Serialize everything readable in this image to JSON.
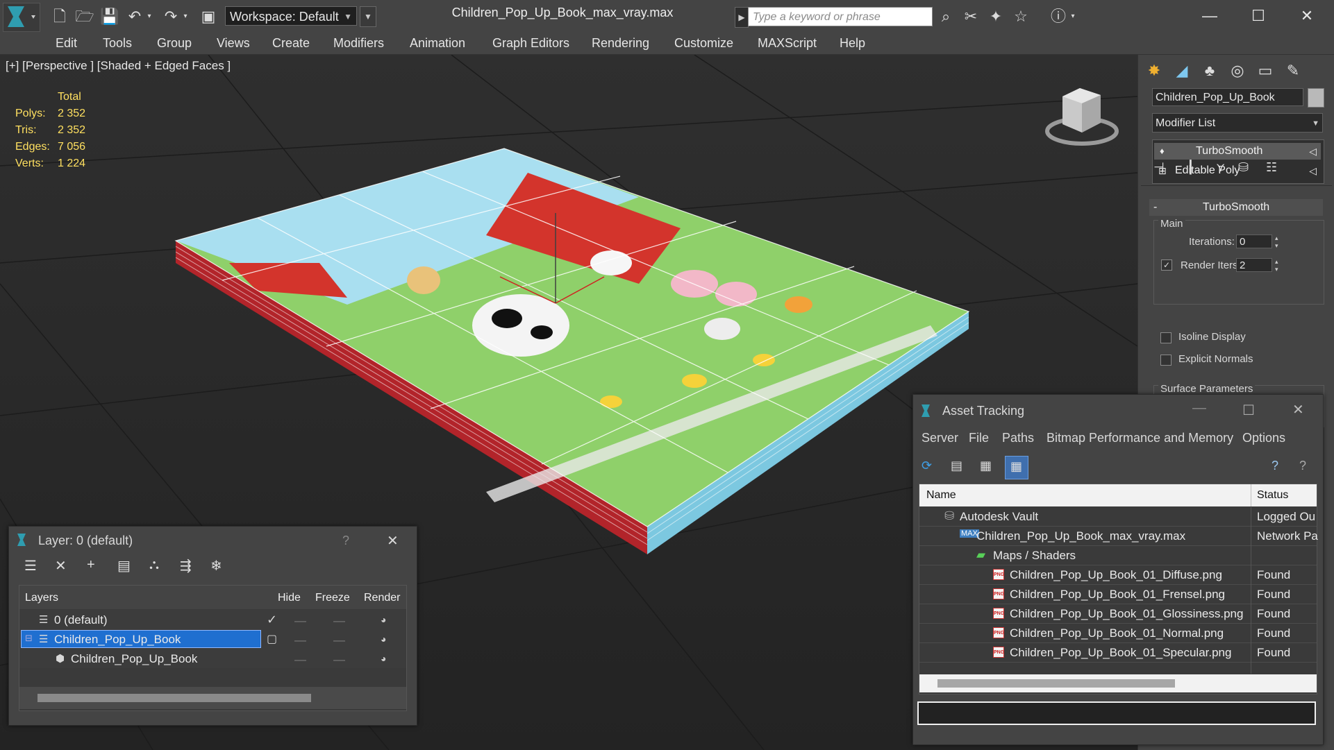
{
  "app": {
    "workspace_label": "Workspace: Default",
    "document_title": "Children_Pop_Up_Book_max_vray.max",
    "search_placeholder": "Type a keyword or phrase"
  },
  "menu": [
    "Edit",
    "Tools",
    "Group",
    "Views",
    "Create",
    "Modifiers",
    "Animation",
    "Graph Editors",
    "Rendering",
    "Customize",
    "MAXScript",
    "Help"
  ],
  "viewport": {
    "label": "[+] [Perspective ] [Shaded + Edged Faces ]",
    "stats": {
      "header": "Total",
      "rows": [
        {
          "label": "Polys:",
          "value": "2 352"
        },
        {
          "label": "Tris:",
          "value": "2 352"
        },
        {
          "label": "Edges:",
          "value": "7 056"
        },
        {
          "label": "Verts:",
          "value": "1 224"
        }
      ]
    }
  },
  "command_panel": {
    "object_name": "Children_Pop_Up_Book",
    "modifier_list": "Modifier List",
    "stack": [
      "TurboSmooth",
      "Editable Poly"
    ],
    "rollout_title": "TurboSmooth",
    "main_label": "Main",
    "iterations_label": "Iterations:",
    "iterations_value": "0",
    "render_iters_label": "Render Iters:",
    "render_iters_value": "2",
    "isoline_label": "Isoline Display",
    "explicit_normals_label": "Explicit Normals",
    "surface_params_label": "Surface Parameters"
  },
  "layer_window": {
    "title": "Layer: 0 (default)",
    "help": "?",
    "columns": [
      "Layers",
      "Hide",
      "Freeze",
      "Render"
    ],
    "rows": [
      "0 (default)",
      "Children_Pop_Up_Book",
      "Children_Pop_Up_Book"
    ]
  },
  "asset_window": {
    "title": "Asset Tracking",
    "menu": [
      "Server",
      "File",
      "Paths",
      "Bitmap Performance and Memory",
      "Options"
    ],
    "columns": [
      "Name",
      "Status"
    ],
    "rows": [
      {
        "name": "Autodesk Vault",
        "status": "Logged Ou"
      },
      {
        "name": "Children_Pop_Up_Book_max_vray.max",
        "status": "Network Pa"
      },
      {
        "name": "Maps / Shaders",
        "status": ""
      },
      {
        "name": "Children_Pop_Up_Book_01_Diffuse.png",
        "status": "Found"
      },
      {
        "name": "Children_Pop_Up_Book_01_Frensel.png",
        "status": "Found"
      },
      {
        "name": "Children_Pop_Up_Book_01_Glossiness.png",
        "status": "Found"
      },
      {
        "name": "Children_Pop_Up_Book_01_Normal.png",
        "status": "Found"
      },
      {
        "name": "Children_Pop_Up_Book_01_Specular.png",
        "status": "Found"
      }
    ]
  }
}
